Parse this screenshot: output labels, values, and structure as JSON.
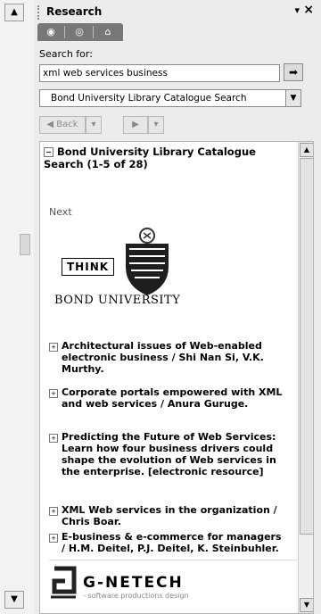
{
  "panel": {
    "title": "Research",
    "dropdown_label": "▾",
    "close_label": "×"
  },
  "nav_tabs": [
    {
      "icon": "home-icon"
    },
    {
      "icon": "globe-icon"
    },
    {
      "icon": "house-icon"
    }
  ],
  "search": {
    "label": "Search for:",
    "value": "xml web services business",
    "go_icon": "arrow-right-icon"
  },
  "source": {
    "selected": "Bond University Library Catalogue Search"
  },
  "history": {
    "back_label": "Back",
    "back_caret": "▾",
    "forward_caret": "▾"
  },
  "results": {
    "header": "Bond University Library Catalogue Search (1-5 of 28)",
    "next_label": "Next",
    "logo": {
      "think": "THINK",
      "university": "BOND UNIVERSITY"
    },
    "items": [
      {
        "text": "Architectural issues of Web-enabled electronic business / Shi Nan Si, V.K. Murthy."
      },
      {
        "text": "Corporate portals empowered with XML and web services / Anura Guruge."
      },
      {
        "text": "Predicting the Future of Web Services: Learn how four business drivers could shape the evolution of Web services in the enterprise. [electronic resource]"
      },
      {
        "text": "XML Web services in the organization / Chris Boar."
      },
      {
        "text": "E-business & e-commerce for managers / H.M. Deitel, P.J. Deitel, K. Steinbuhler."
      }
    ],
    "footer_logo": {
      "brand": "G-NETECH",
      "tagline": "- software productions design"
    }
  },
  "colors": {
    "pane_bg": "#ececec",
    "tab_bg": "#777777",
    "results_bg": "#ffffff"
  }
}
